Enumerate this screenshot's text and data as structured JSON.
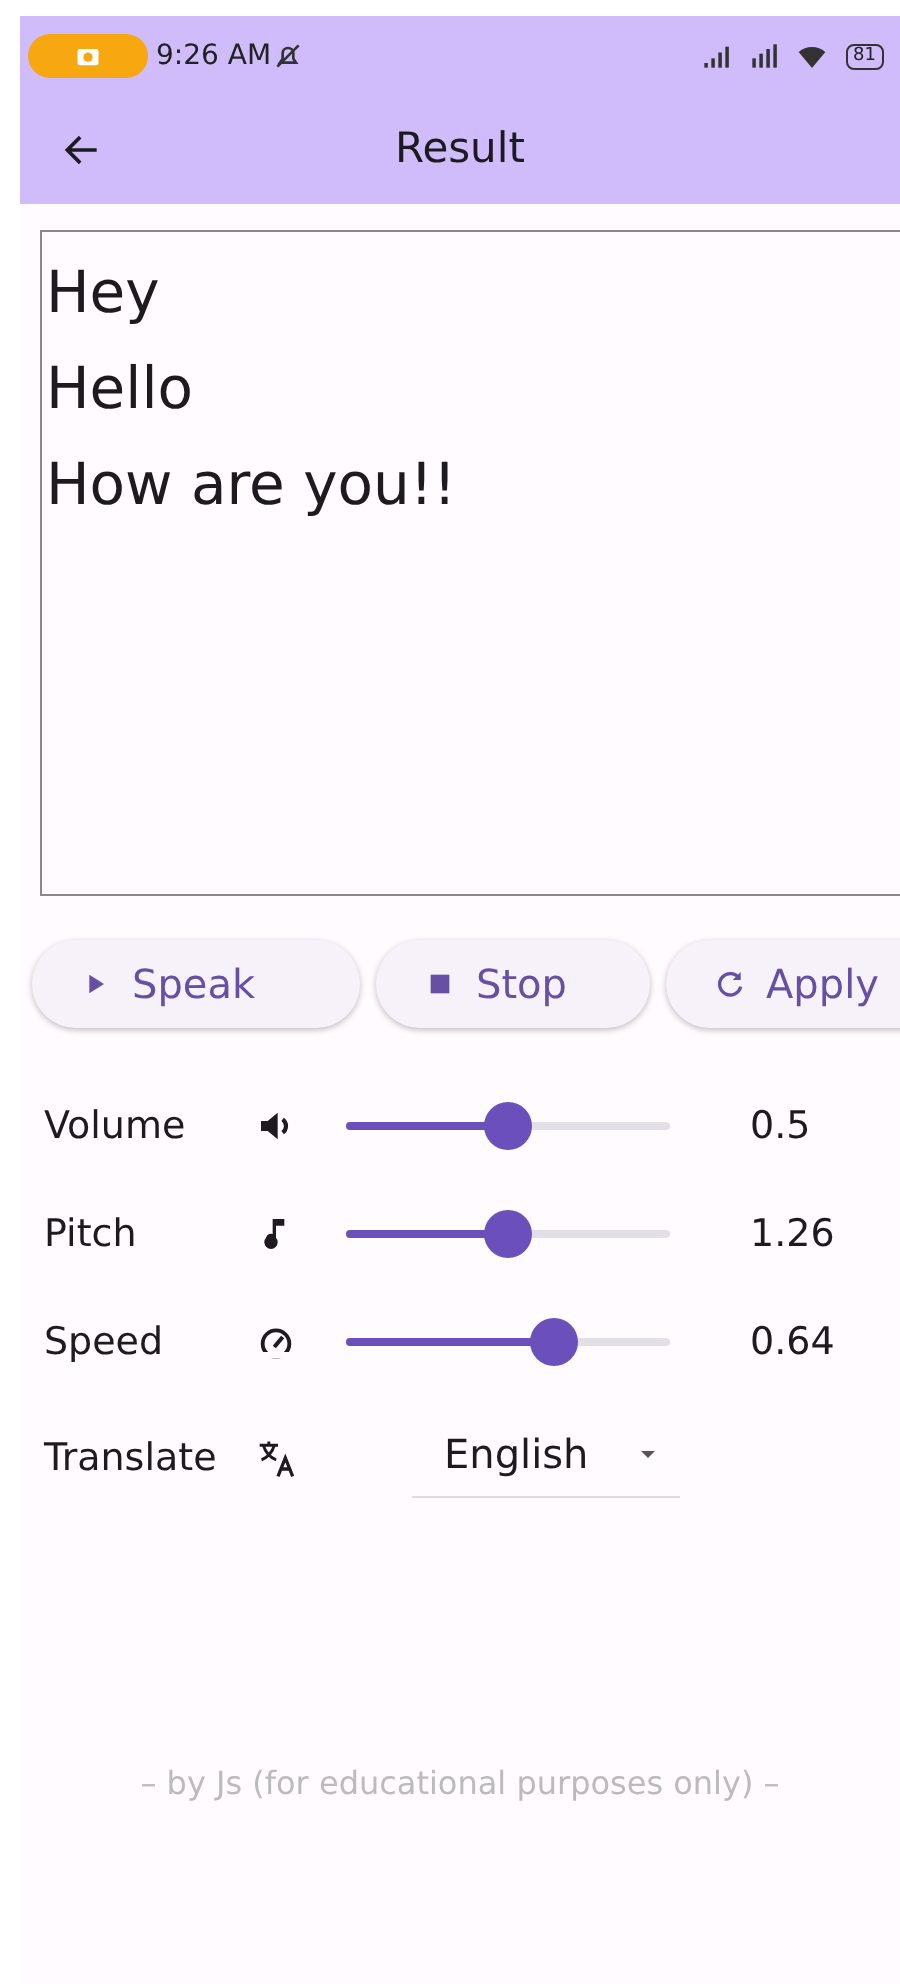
{
  "status_bar": {
    "time": "9:26 AM",
    "battery": "81"
  },
  "app_bar": {
    "title": "Result"
  },
  "result_text": [
    "Hey",
    "Hello",
    "How are you!!"
  ],
  "buttons": [
    {
      "kind": "play",
      "label": "Speak"
    },
    {
      "kind": "stop",
      "label": "Stop"
    },
    {
      "kind": "refresh",
      "label": "Apply"
    }
  ],
  "sliders": [
    {
      "label": "Volume",
      "kind": "volume",
      "level": 0.5,
      "reading": "0.5"
    },
    {
      "label": "Pitch",
      "kind": "note",
      "level": 0.5,
      "reading": "1.26"
    },
    {
      "label": "Speed",
      "kind": "speed",
      "level": 0.64,
      "reading": "0.64"
    }
  ],
  "translate": {
    "label": "Translate",
    "value": "English"
  },
  "footer": "– by Js (for educational purposes only) –"
}
